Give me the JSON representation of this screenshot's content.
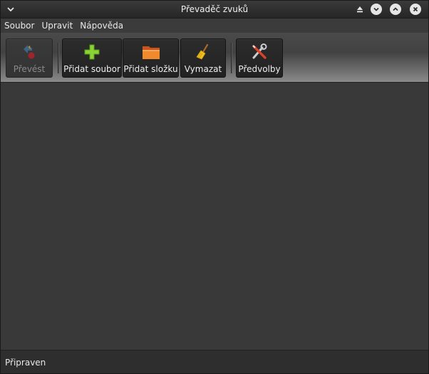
{
  "window": {
    "title": "Převaděč zvuků"
  },
  "menubar": {
    "items": [
      "Soubor",
      "Upravit",
      "Nápověda"
    ]
  },
  "toolbar": {
    "convert": "Převést",
    "add_file": "Přidat soubor",
    "add_folder": "Přidat složku",
    "clear": "Vymazat",
    "preferences": "Předvolby"
  },
  "statusbar": {
    "text": "Připraven"
  },
  "colors": {
    "window_bg": "#393939",
    "add_green": "#8bd234",
    "folder_orange": "#e8701f"
  }
}
